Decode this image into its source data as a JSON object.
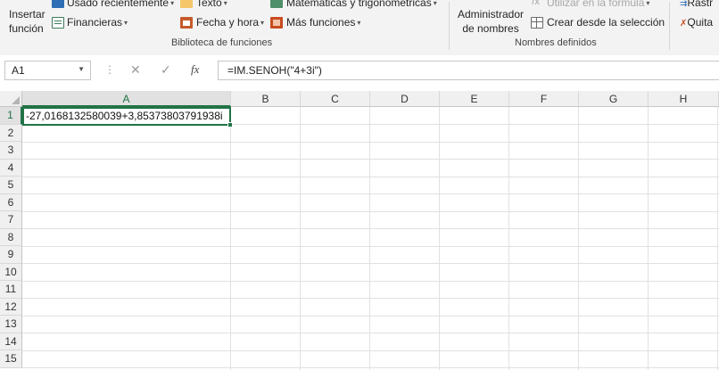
{
  "ribbon": {
    "insert_function": {
      "line1": "Insertar",
      "line2": "función"
    },
    "recently_used": "Usado recientemente",
    "financial": "Financieras",
    "text": "Texto",
    "date_time": "Fecha y hora",
    "math_trig": "Matemáticas y trigonométricas",
    "more_functions": "Más funciones",
    "library_group": "Biblioteca de funciones",
    "name_manager": {
      "line1": "Administrador",
      "line2": "de nombres"
    },
    "use_in_formula": "Utilizar en la fórmula",
    "create_from_selection": "Crear desde la selección",
    "defined_names_group": "Nombres definidos",
    "trace": "Rastr",
    "remove": "Quita",
    "colors": {
      "financial": "#3c7d5a",
      "text": "#e2a84b",
      "date": "#c55a2a",
      "math": "#4f8f6a",
      "more": "#c84b1f",
      "recent": "#2e6fb5"
    }
  },
  "formula_bar": {
    "name_box": "A1",
    "cancel_icon": "✕",
    "enter_icon": "✓",
    "fx": "fx",
    "formula": "=IM.SENOH(\"4+3i\")"
  },
  "columns": [
    "A",
    "B",
    "C",
    "D",
    "E",
    "F",
    "G",
    "H"
  ],
  "rows": [
    "1",
    "2",
    "3",
    "4",
    "5",
    "6",
    "7",
    "8",
    "9",
    "10",
    "11",
    "12",
    "13",
    "14",
    "15"
  ],
  "cells": {
    "A1": "-27,0168132580039+3,85373803791938i"
  },
  "accent": "#217346"
}
